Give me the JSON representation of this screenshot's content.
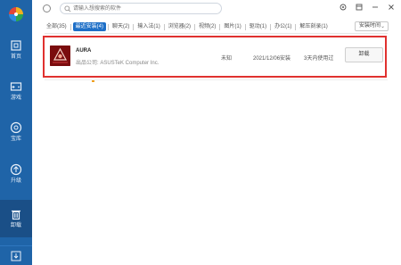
{
  "sidebar": {
    "logo": "pinwheel-logo",
    "items": [
      {
        "label": "首页",
        "icon": "home-icon"
      },
      {
        "label": "游戏",
        "icon": "gamepad-icon"
      },
      {
        "label": "宝库",
        "icon": "treasure-icon"
      },
      {
        "label": "升级",
        "icon": "upgrade-icon"
      },
      {
        "label": "卸载",
        "icon": "trash-icon",
        "active": true
      }
    ],
    "bottom_icon": "download-icon"
  },
  "search": {
    "placeholder": "请输入想搜索的软件"
  },
  "window_controls": [
    "settings-icon",
    "skin-icon",
    "minimize-icon",
    "close-icon"
  ],
  "tabs": [
    {
      "label": "全部(35)"
    },
    {
      "label": "最近安装(4)",
      "active": true
    },
    {
      "label": "聊天(2)"
    },
    {
      "label": "输入法(1)"
    },
    {
      "label": "浏览器(2)"
    },
    {
      "label": "视频(2)"
    },
    {
      "label": "图片(1)"
    },
    {
      "label": "驱动(1)"
    },
    {
      "label": "办公(1)"
    },
    {
      "label": "解压刻录(1)"
    }
  ],
  "sort": {
    "label": "安装时间"
  },
  "apps": [
    {
      "name": "AURA",
      "publisher": "出品公司: ASUSTeK Computer Inc.",
      "size": "未知",
      "install_date": "2021/12/06安装",
      "usage": "3天内使用过",
      "action": "卸载"
    }
  ],
  "colors": {
    "sidebar": "#1f64a8",
    "accent": "#1e6fc7",
    "highlight": "#e0312f",
    "app_icon_bg": "#7a0c0e"
  }
}
